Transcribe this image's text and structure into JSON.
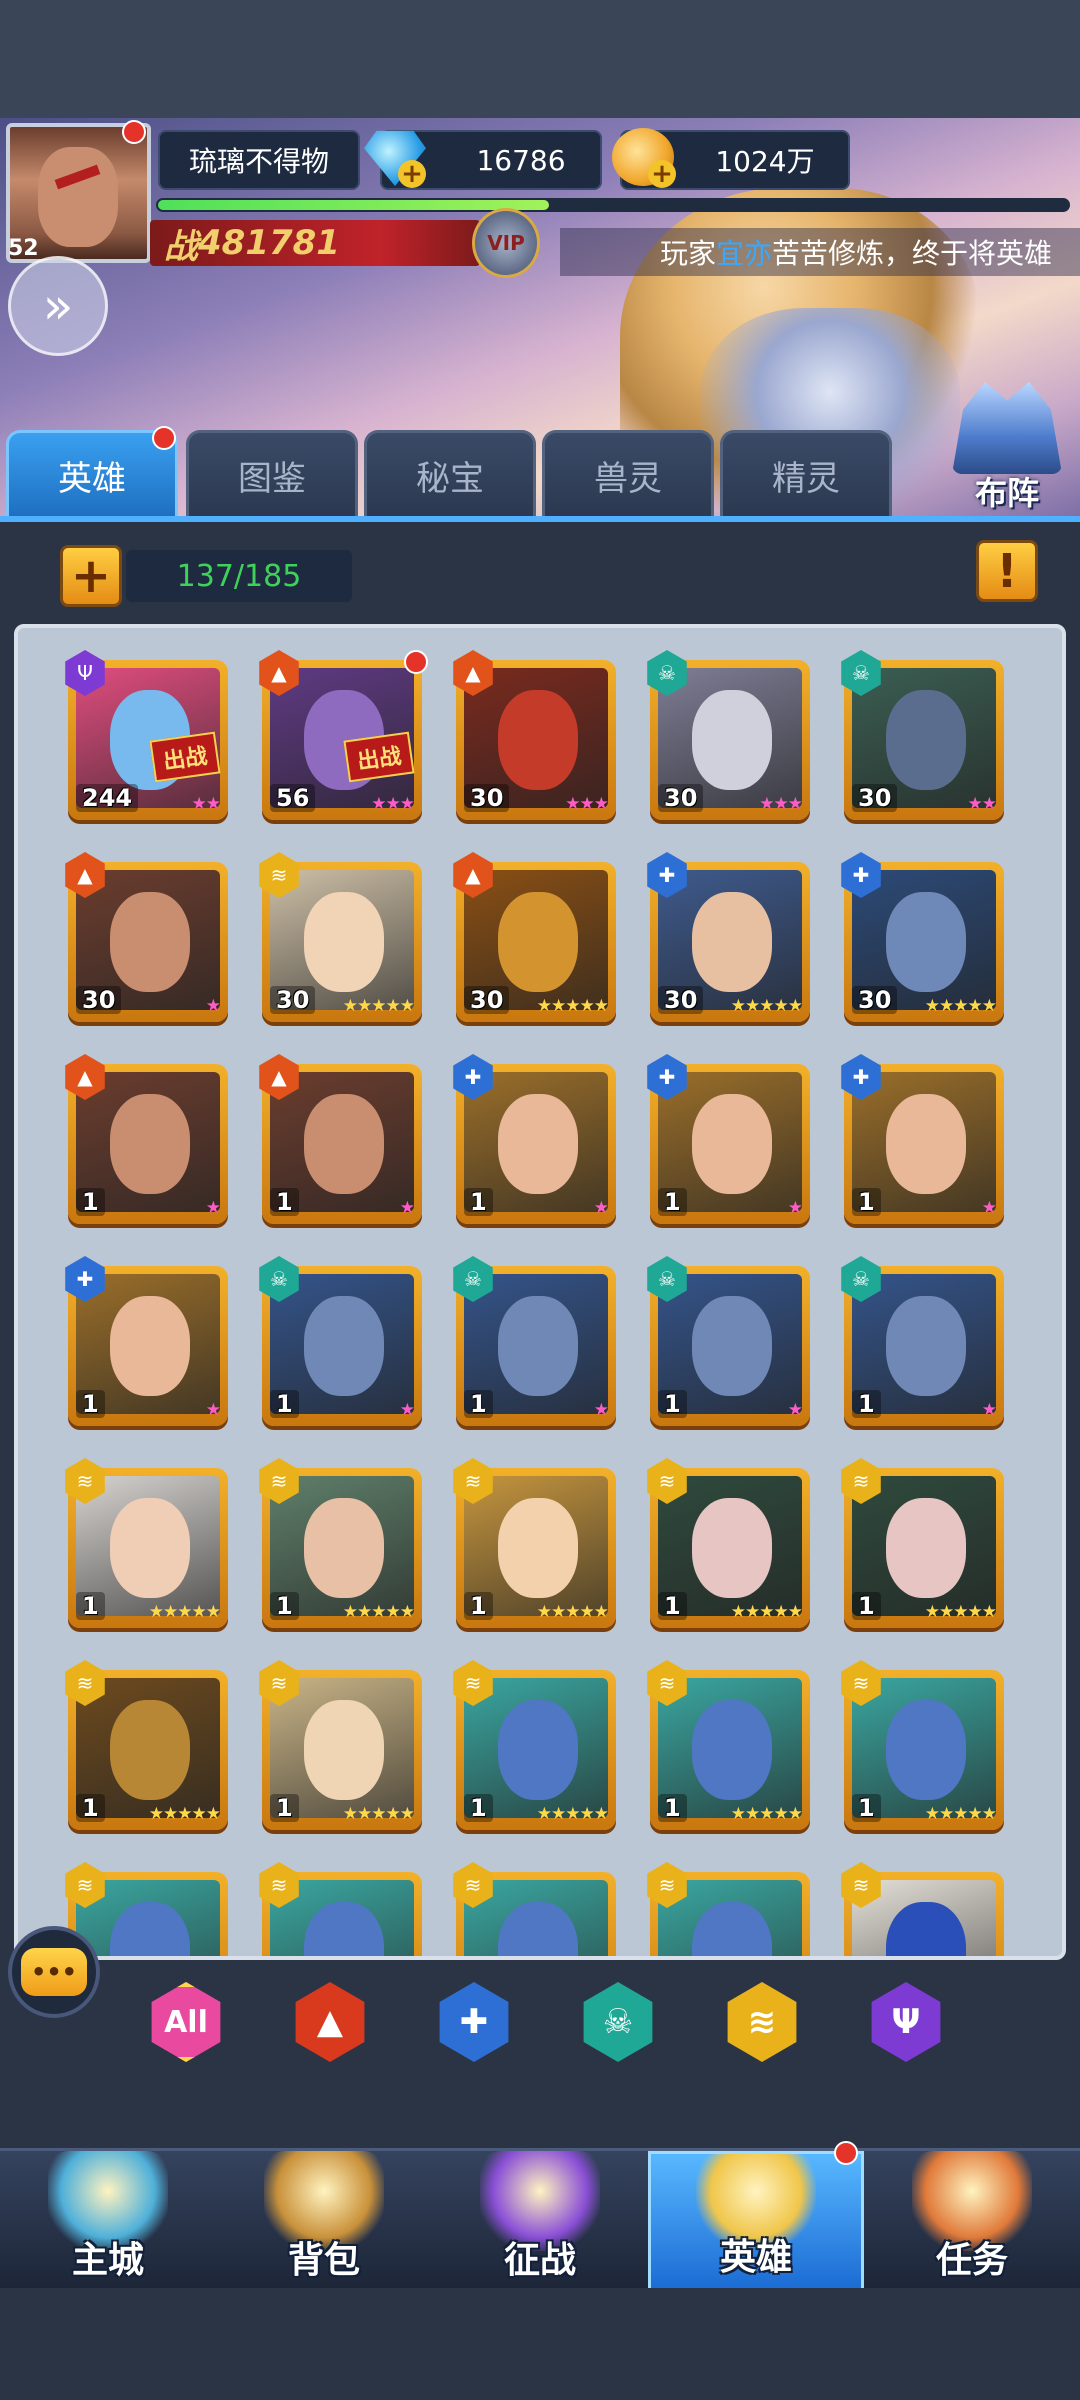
{
  "player": {
    "name": "琉璃不得物",
    "level": "52",
    "gems": "16786",
    "gold": "1024万",
    "power_prefix": "战",
    "power": "481781",
    "vip": "VIP",
    "xp_fraction": 0.43
  },
  "marquee": {
    "prefix": "玩家",
    "highlight": "宜亦",
    "suffix": "苦苦修炼，终于将英雄"
  },
  "formation_label": "布阵",
  "tabs": [
    "英雄",
    "图鉴",
    "秘宝",
    "兽灵",
    "精灵"
  ],
  "hero_count": "137/185",
  "info_label": "!",
  "heroes": [
    {
      "level": "244",
      "stars": "★★",
      "star_color": "pink",
      "element": "dark",
      "badge": "出战",
      "bg": "#e04d7e",
      "face": "#78b9ee"
    },
    {
      "level": "56",
      "stars": "★★★",
      "star_color": "pink",
      "element": "fire",
      "badge": "出战",
      "bg": "#5f3a83",
      "face": "#8f6bbf",
      "dot": true
    },
    {
      "level": "30",
      "stars": "★★★",
      "star_color": "pink",
      "element": "fire",
      "bg": "#7a2a1e",
      "face": "#c43b2a"
    },
    {
      "level": "30",
      "stars": "★★★",
      "star_color": "pink",
      "element": "nature",
      "bg": "#7e7d95",
      "face": "#cfd0dc"
    },
    {
      "level": "30",
      "stars": "★★",
      "star_color": "pink",
      "element": "nature",
      "bg": "#3b5e52",
      "face": "#5a6d8f"
    },
    {
      "level": "30",
      "stars": "★",
      "star_color": "pink",
      "element": "fire",
      "bg": "#6b3d2e",
      "face": "#c98d70"
    },
    {
      "level": "30",
      "stars": "★★★★★",
      "star_color": "yellow",
      "element": "light",
      "bg": "#cdbfa6",
      "face": "#f1d3b5"
    },
    {
      "level": "30",
      "stars": "★★★★★",
      "star_color": "yellow",
      "element": "fire",
      "bg": "#8a4f14",
      "face": "#d39430"
    },
    {
      "level": "30",
      "stars": "★★★★★",
      "star_color": "yellow",
      "element": "water",
      "bg": "#3e5a8d",
      "face": "#e7bfa1"
    },
    {
      "level": "30",
      "stars": "★★★★★",
      "star_color": "yellow",
      "element": "water",
      "bg": "#2c4a78",
      "face": "#6e88b7"
    },
    {
      "level": "1",
      "stars": "★",
      "star_color": "pink",
      "element": "fire",
      "bg": "#6b3d2e",
      "face": "#c98d70"
    },
    {
      "level": "1",
      "stars": "★",
      "star_color": "pink",
      "element": "fire",
      "bg": "#6b3d2e",
      "face": "#c98d70"
    },
    {
      "level": "1",
      "stars": "★",
      "star_color": "pink",
      "element": "water",
      "bg": "#9a6e2a",
      "face": "#e8b898"
    },
    {
      "level": "1",
      "stars": "★",
      "star_color": "pink",
      "element": "water",
      "bg": "#9a6e2a",
      "face": "#e8b898"
    },
    {
      "level": "1",
      "stars": "★",
      "star_color": "pink",
      "element": "water",
      "bg": "#9a6e2a",
      "face": "#e8b898"
    },
    {
      "level": "1",
      "stars": "★",
      "star_color": "pink",
      "element": "water",
      "bg": "#9a6e2a",
      "face": "#e8b898"
    },
    {
      "level": "1",
      "stars": "★",
      "star_color": "pink",
      "element": "nature",
      "bg": "#34548a",
      "face": "#6f88b5"
    },
    {
      "level": "1",
      "stars": "★",
      "star_color": "pink",
      "element": "nature",
      "bg": "#34548a",
      "face": "#6f88b5"
    },
    {
      "level": "1",
      "stars": "★",
      "star_color": "pink",
      "element": "nature",
      "bg": "#34548a",
      "face": "#6f88b5"
    },
    {
      "level": "1",
      "stars": "★",
      "star_color": "pink",
      "element": "nature",
      "bg": "#34548a",
      "face": "#6f88b5"
    },
    {
      "level": "1",
      "stars": "★★★★★",
      "star_color": "yellow",
      "element": "light",
      "bg": "#d6d3cf",
      "face": "#f0cdb5"
    },
    {
      "level": "1",
      "stars": "★★★★★",
      "star_color": "yellow",
      "element": "light",
      "bg": "#5f7f6a",
      "face": "#e8c0a6"
    },
    {
      "level": "1",
      "stars": "★★★★★",
      "star_color": "yellow",
      "element": "light",
      "bg": "#c5953e",
      "face": "#f4d1ad"
    },
    {
      "level": "1",
      "stars": "★★★★★",
      "star_color": "yellow",
      "element": "light",
      "bg": "#2f4a3d",
      "face": "#e7c5c2"
    },
    {
      "level": "1",
      "stars": "★★★★★",
      "star_color": "yellow",
      "element": "light",
      "bg": "#2f4a3d",
      "face": "#e7c5c2"
    },
    {
      "level": "1",
      "stars": "★★★★★",
      "star_color": "yellow",
      "element": "light",
      "bg": "#6d4a1e",
      "face": "#b88735"
    },
    {
      "level": "1",
      "stars": "★★★★★",
      "star_color": "yellow",
      "element": "light",
      "bg": "#c9b487",
      "face": "#f0d5b5"
    },
    {
      "level": "1",
      "stars": "★★★★★",
      "star_color": "yellow",
      "element": "light",
      "bg": "#3aa6a0",
      "face": "#4f77c4"
    },
    {
      "level": "1",
      "stars": "★★★★★",
      "star_color": "yellow",
      "element": "light",
      "bg": "#3aa6a0",
      "face": "#4f77c4"
    },
    {
      "level": "1",
      "stars": "★★★★★",
      "star_color": "yellow",
      "element": "light",
      "bg": "#3aa6a0",
      "face": "#4f77c4"
    },
    {
      "level": "",
      "stars": "",
      "star_color": "yellow",
      "element": "light",
      "bg": "#3aa6a0",
      "face": "#4f77c4"
    },
    {
      "level": "",
      "stars": "",
      "star_color": "yellow",
      "element": "light",
      "bg": "#3aa6a0",
      "face": "#4f77c4"
    },
    {
      "level": "",
      "stars": "",
      "star_color": "yellow",
      "element": "light",
      "bg": "#3aa6a0",
      "face": "#4f77c4"
    },
    {
      "level": "",
      "stars": "",
      "star_color": "yellow",
      "element": "light",
      "bg": "#3aa6a0",
      "face": "#4f77c4"
    },
    {
      "level": "",
      "stars": "",
      "star_color": "yellow",
      "element": "light",
      "bg": "#e4e0d8",
      "face": "#2a4fb8"
    }
  ],
  "element_colors": {
    "dark": "#7d3bd3",
    "fire": "#e2531b",
    "nature": "#1fa895",
    "water": "#2e6fd6",
    "light": "#e9b21a"
  },
  "element_icons": {
    "dark": "trident-icon",
    "fire": "flame-icon",
    "nature": "skull-icon",
    "water": "cross-icon",
    "light": "wing-icon"
  },
  "filters": [
    {
      "label": "All",
      "name": "filter-all-button",
      "color": "#e94aa0"
    },
    {
      "label": "▲",
      "name": "filter-fire-button",
      "color": "#d9391c"
    },
    {
      "label": "✚",
      "name": "filter-water-button",
      "color": "#2e6fd6"
    },
    {
      "label": "☠",
      "name": "filter-nature-button",
      "color": "#1fa895"
    },
    {
      "label": "≋",
      "name": "filter-light-button",
      "color": "#e9b21a"
    },
    {
      "label": "Ψ",
      "name": "filter-dark-button",
      "color": "#7d3bd3"
    }
  ],
  "chat_label": "•••",
  "nav": [
    {
      "label": "主城",
      "name": "nav-main-city",
      "icon_color": "#4fb0d9"
    },
    {
      "label": "背包",
      "name": "nav-backpack",
      "icon_color": "#c9913a"
    },
    {
      "label": "征战",
      "name": "nav-campaign",
      "icon_color": "#8a4fd6"
    },
    {
      "label": "英雄",
      "name": "nav-heroes",
      "icon_color": "#f0c64a",
      "active": true
    },
    {
      "label": "任务",
      "name": "nav-tasks",
      "icon_color": "#e07a3a"
    }
  ]
}
